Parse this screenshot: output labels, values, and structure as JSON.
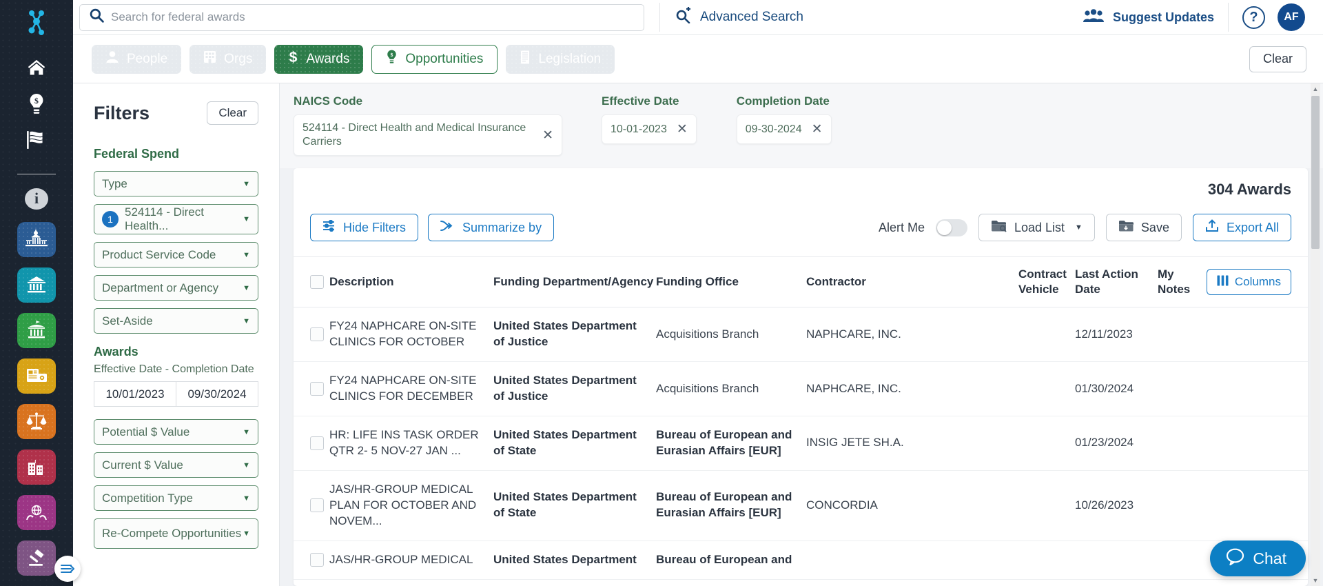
{
  "rail": {
    "logo_icon": "molecule-logo-icon",
    "nav": [
      {
        "name": "home-icon",
        "label": "Home"
      },
      {
        "name": "lightbulb-dollar-icon",
        "label": "Opportunities"
      },
      {
        "name": "flag-icon",
        "label": "Legislation"
      }
    ],
    "info_label": "i",
    "tiles": [
      {
        "name": "capitol-dome-icon",
        "color": "#2b5c94"
      },
      {
        "name": "bank-building-icon",
        "color": "#1195ac"
      },
      {
        "name": "government-building-icon",
        "color": "#2f9e46"
      },
      {
        "name": "news-media-icon",
        "color": "#d8a316"
      },
      {
        "name": "scales-of-justice-icon",
        "color": "#d9731f"
      },
      {
        "name": "city-buildings-icon",
        "color": "#b0314a"
      },
      {
        "name": "globe-in-hands-icon",
        "color": "#9c3585"
      },
      {
        "name": "gavel-icon",
        "color": "#7e5484"
      }
    ]
  },
  "header": {
    "search": {
      "icon": "search-icon",
      "placeholder": "Search for federal awards",
      "value": ""
    },
    "advanced_search": {
      "icon": "advanced-search-icon",
      "label": "Advanced Search"
    },
    "suggest_updates": {
      "icon": "users-group-icon",
      "label": "Suggest Updates"
    },
    "help": {
      "icon": "help-circle-icon",
      "label": "?"
    },
    "avatar": {
      "label": "AF"
    }
  },
  "tabs": {
    "items": [
      {
        "label": "People",
        "icon": "person-icon",
        "state": "disabled"
      },
      {
        "label": "Orgs",
        "icon": "building-icon",
        "state": "disabled"
      },
      {
        "label": "Awards",
        "icon": "dollar-icon",
        "state": "active"
      },
      {
        "label": "Opportunities",
        "icon": "lightbulb-dollar-icon",
        "state": "outline"
      },
      {
        "label": "Legislation",
        "icon": "document-icon",
        "state": "disabled"
      }
    ],
    "clear_label": "Clear"
  },
  "filters": {
    "title": "Filters",
    "clear_label": "Clear",
    "federal_spend_label": "Federal Spend",
    "selects": [
      {
        "label": "Type",
        "count": null
      },
      {
        "label": "524114 - Direct Health...",
        "count": "1"
      },
      {
        "label": "Product Service Code",
        "count": null
      },
      {
        "label": "Department or Agency",
        "count": null
      },
      {
        "label": "Set-Aside",
        "count": null
      }
    ],
    "awards_label": "Awards",
    "date_range_label": "Effective Date - Completion Date",
    "date_from": "10/01/2023",
    "date_to": "09/30/2024",
    "selects2": [
      {
        "label": "Potential $ Value"
      },
      {
        "label": "Current $ Value"
      },
      {
        "label": "Competition Type"
      },
      {
        "label": "Re-Compete Opportunities"
      }
    ]
  },
  "criteria": [
    {
      "label": "NAICS Code",
      "value": "524114 - Direct Health and Medical Insurance Carriers",
      "remove_icon": "close-icon"
    },
    {
      "label": "Effective Date",
      "value": "10-01-2023",
      "remove_icon": "close-icon"
    },
    {
      "label": "Completion Date",
      "value": "09-30-2024",
      "remove_icon": "close-icon"
    }
  ],
  "results": {
    "count_label": "304 Awards",
    "hide_filters_label": "Hide Filters",
    "summarize_label": "Summarize by",
    "alert_me_label": "Alert Me",
    "alert_me_on": false,
    "load_list_label": "Load List",
    "save_label": "Save",
    "export_label": "Export All",
    "columns_label": "Columns"
  },
  "table": {
    "headers": [
      "Description",
      "Funding Department/Agency",
      "Funding Office",
      "Contractor",
      "Contract Vehicle",
      "Last Action Date",
      "My Notes"
    ],
    "rows": [
      {
        "description": "FY24 NAPHCARE ON-SITE CLINICS FOR OCTOBER",
        "department": "United States Department of Justice",
        "office": "Acquisitions Branch",
        "contractor": "NAPHCARE, INC.",
        "vehicle": "",
        "last_action": "12/11/2023",
        "notes": ""
      },
      {
        "description": "FY24 NAPHCARE ON-SITE CLINICS FOR DECEMBER",
        "department": "United States Department of Justice",
        "office": "Acquisitions Branch",
        "contractor": "NAPHCARE, INC.",
        "vehicle": "",
        "last_action": "01/30/2024",
        "notes": ""
      },
      {
        "description": "HR: LIFE INS TASK ORDER QTR 2- 5 NOV-27 JAN ...",
        "department": "United States Department of State",
        "office": "Bureau of European and Eurasian Affairs [EUR]",
        "contractor": "INSIG JETE SH.A.",
        "vehicle": "",
        "last_action": "01/23/2024",
        "notes": ""
      },
      {
        "description": "JAS/HR-GROUP MEDICAL PLAN FOR OCTOBER AND NOVEM...",
        "department": "United States Department of State",
        "office": "Bureau of European and Eurasian Affairs [EUR]",
        "contractor": "CONCORDIA",
        "vehicle": "",
        "last_action": "10/26/2023",
        "notes": ""
      },
      {
        "description": "JAS/HR-GROUP MEDICAL",
        "department": "United States Department",
        "office": "Bureau of European and",
        "contractor": "",
        "vehicle": "",
        "last_action": "",
        "notes": ""
      }
    ]
  },
  "chat": {
    "label": "Chat",
    "icon": "chat-bubble-icon"
  },
  "colors": {
    "green": "#2d7c4a",
    "blue": "#1b7ac4",
    "navy": "#1b4e86",
    "rail": "#1b2430"
  }
}
